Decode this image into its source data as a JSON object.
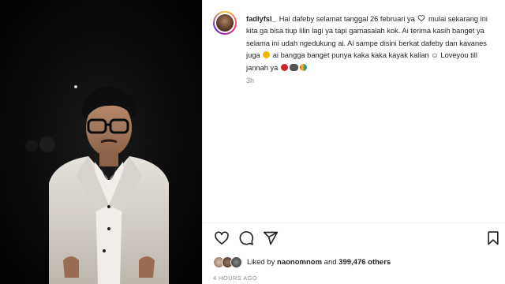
{
  "post": {
    "username": "fadlyfsl_",
    "caption": {
      "p1": "Hai dafeby selamat tanggal 26 februari ya",
      "p2": " mulai sekarang ini kita ga bisa tiup lilin lagi ya tapi gamasalah kok. Ai terima kasih banget ya selama ini udah ngedukung ai. Ai sampe disini berkat dafeby dan kavanes juga",
      "p3": " ai bangga banget punya kaka kaka kayak kalian",
      "p4": " Loveyou till jannah ya",
      "smile_glyph": "☺"
    },
    "time_short": "3h",
    "time_long": "4 HOURS AGO"
  },
  "likes": {
    "prefix": "Liked by ",
    "user": "naonomnom",
    "and": " and ",
    "count": "399,476 others"
  },
  "icons": {
    "like": "heart-icon",
    "comment": "comment-icon",
    "share": "send-icon",
    "save": "bookmark-icon"
  },
  "colors": {
    "text": "#262626",
    "muted": "#8e8e8e",
    "divider": "#efefef",
    "photo_bg": "#050505"
  }
}
